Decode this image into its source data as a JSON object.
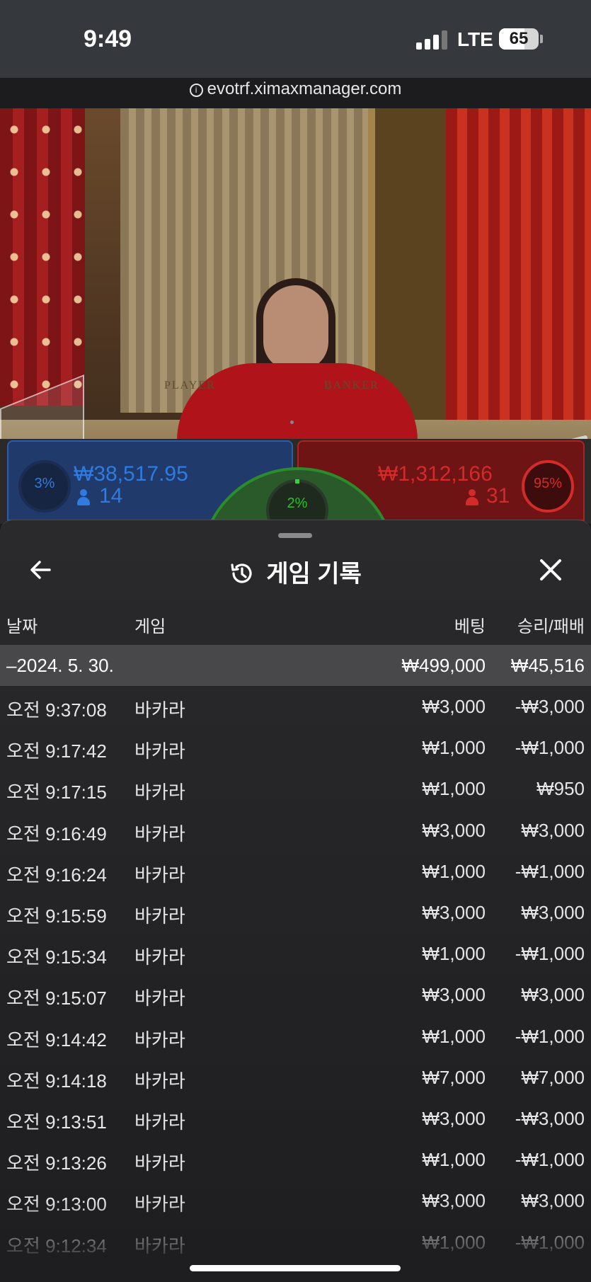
{
  "status_bar": {
    "time": "9:49",
    "network": "LTE",
    "battery": "65",
    "battery_level": 0.65
  },
  "browser": {
    "url": "evotrf.ximaxmanager.com"
  },
  "video": {
    "table_player_label": "PLAYER",
    "table_banker_label": "BANKER"
  },
  "bet_stats": {
    "player": {
      "percent": "3%",
      "amount": "₩38,517.95",
      "count": "14",
      "color": "#2f7be0"
    },
    "tie": {
      "percent": "2%",
      "color": "#2fbf2f"
    },
    "banker": {
      "percent": "95%",
      "amount": "₩1,312,166",
      "count": "31",
      "color": "#d42a2a"
    }
  },
  "history": {
    "title": "게임 기록",
    "icons": {
      "back": "arrow-left-icon",
      "title": "history-icon",
      "close": "close-icon"
    },
    "columns": {
      "date": "날짜",
      "game": "게임",
      "bet": "베팅",
      "result": "승리/패배"
    },
    "date_group": {
      "date": "–2024. 5. 30.",
      "bet_total": "₩499,000",
      "result_total": "₩45,516"
    },
    "rows": [
      {
        "time": "오전 9:37:08",
        "game": "바카라",
        "bet": "₩3,000",
        "result": "-₩3,000"
      },
      {
        "time": "오전 9:17:42",
        "game": "바카라",
        "bet": "₩1,000",
        "result": "-₩1,000"
      },
      {
        "time": "오전 9:17:15",
        "game": "바카라",
        "bet": "₩1,000",
        "result": "₩950"
      },
      {
        "time": "오전 9:16:49",
        "game": "바카라",
        "bet": "₩3,000",
        "result": "₩3,000"
      },
      {
        "time": "오전 9:16:24",
        "game": "바카라",
        "bet": "₩1,000",
        "result": "-₩1,000"
      },
      {
        "time": "오전 9:15:59",
        "game": "바카라",
        "bet": "₩3,000",
        "result": "₩3,000"
      },
      {
        "time": "오전 9:15:34",
        "game": "바카라",
        "bet": "₩1,000",
        "result": "-₩1,000"
      },
      {
        "time": "오전 9:15:07",
        "game": "바카라",
        "bet": "₩3,000",
        "result": "₩3,000"
      },
      {
        "time": "오전 9:14:42",
        "game": "바카라",
        "bet": "₩1,000",
        "result": "-₩1,000"
      },
      {
        "time": "오전 9:14:18",
        "game": "바카라",
        "bet": "₩7,000",
        "result": "₩7,000"
      },
      {
        "time": "오전 9:13:51",
        "game": "바카라",
        "bet": "₩3,000",
        "result": "-₩3,000"
      },
      {
        "time": "오전 9:13:26",
        "game": "바카라",
        "bet": "₩1,000",
        "result": "-₩1,000"
      },
      {
        "time": "오전 9:13:00",
        "game": "바카라",
        "bet": "₩3,000",
        "result": "₩3,000"
      },
      {
        "time": "오전 9:12:34",
        "game": "바카라",
        "bet": "₩1,000",
        "result": "-₩1,000"
      }
    ]
  }
}
